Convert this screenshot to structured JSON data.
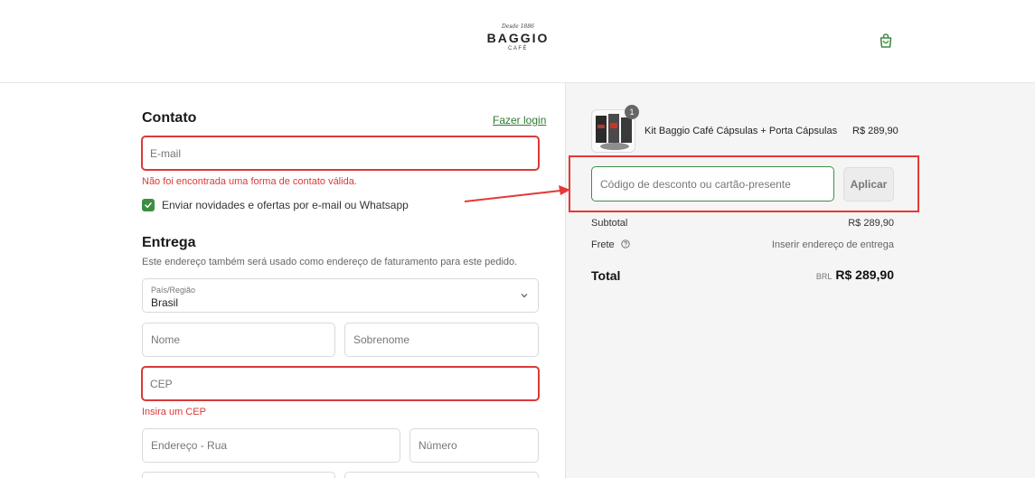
{
  "header": {
    "logo_script": "Desde 1886",
    "logo_main": "BAGGIO",
    "logo_sub": "CAFÉ"
  },
  "contact": {
    "title": "Contato",
    "login_link": "Fazer login",
    "email_placeholder": "E-mail",
    "error": "Não foi encontrada uma forma de contato válida.",
    "newsletter_label": "Enviar novidades e ofertas por e-mail ou Whatsapp",
    "newsletter_checked": true
  },
  "delivery": {
    "title": "Entrega",
    "subtitle": "Este endereço também será usado como endereço de faturamento para este pedido.",
    "country_label": "País/Região",
    "country_value": "Brasil",
    "first_name_placeholder": "Nome",
    "last_name_placeholder": "Sobrenome",
    "cep_placeholder": "CEP",
    "cep_error": "Insira um CEP",
    "street_placeholder": "Endereço - Rua",
    "number_placeholder": "Número"
  },
  "order": {
    "item": {
      "name": "Kit Baggio Café Cápsulas + Porta Cápsulas",
      "price": "R$ 289,90",
      "quantity": "1"
    },
    "discount_placeholder": "Código de desconto ou cartão-presente",
    "apply_label": "Aplicar",
    "subtotal_label": "Subtotal",
    "subtotal_value": "R$ 289,90",
    "shipping_label": "Frete",
    "shipping_value": "Inserir endereço de entrega",
    "total_label": "Total",
    "total_currency": "BRL",
    "total_value": "R$ 289,90"
  },
  "colors": {
    "accent_green": "#3e8e41",
    "error_red": "#d93a3a",
    "annotation_red": "#e53935"
  }
}
